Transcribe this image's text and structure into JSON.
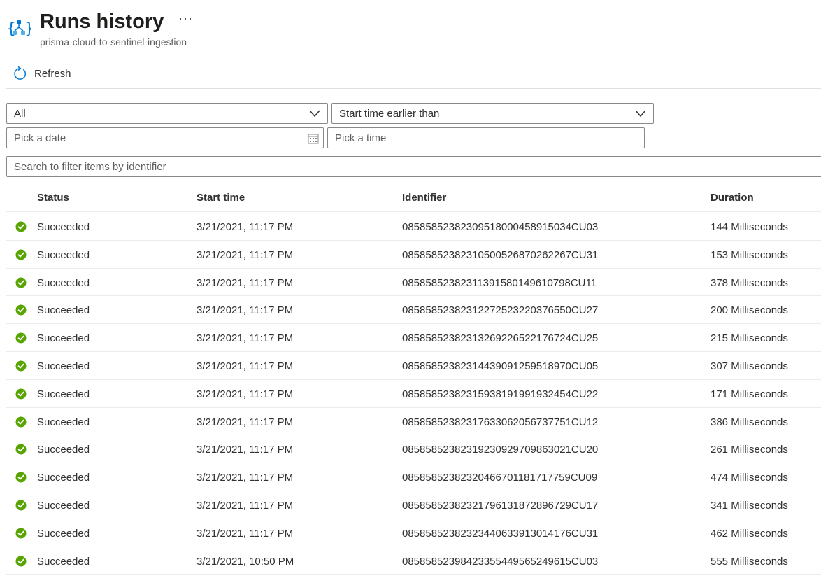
{
  "header": {
    "title": "Runs history",
    "more_label": "···",
    "subtitle": "prisma-cloud-to-sentinel-ingestion",
    "icon": "logic-app-icon"
  },
  "toolbar": {
    "refresh_label": "Refresh",
    "refresh_icon": "refresh-icon"
  },
  "filters": {
    "status_value": "All",
    "time_filter_value": "Start time earlier than",
    "date_placeholder": "Pick a date",
    "time_placeholder": "Pick a time",
    "search_placeholder": "Search to filter items by identifier"
  },
  "table": {
    "columns": {
      "status": "Status",
      "start_time": "Start time",
      "identifier": "Identifier",
      "duration": "Duration"
    },
    "rows": [
      {
        "status": "Succeeded",
        "start_time": "3/21/2021, 11:17 PM",
        "identifier": "08585852382309518000458915034CU03",
        "duration": "144 Milliseconds"
      },
      {
        "status": "Succeeded",
        "start_time": "3/21/2021, 11:17 PM",
        "identifier": "08585852382310500526870262267CU31",
        "duration": "153 Milliseconds"
      },
      {
        "status": "Succeeded",
        "start_time": "3/21/2021, 11:17 PM",
        "identifier": "08585852382311391580149610798CU11",
        "duration": "378 Milliseconds"
      },
      {
        "status": "Succeeded",
        "start_time": "3/21/2021, 11:17 PM",
        "identifier": "08585852382312272523220376550CU27",
        "duration": "200 Milliseconds"
      },
      {
        "status": "Succeeded",
        "start_time": "3/21/2021, 11:17 PM",
        "identifier": "08585852382313269226522176724CU25",
        "duration": "215 Milliseconds"
      },
      {
        "status": "Succeeded",
        "start_time": "3/21/2021, 11:17 PM",
        "identifier": "08585852382314439091259518970CU05",
        "duration": "307 Milliseconds"
      },
      {
        "status": "Succeeded",
        "start_time": "3/21/2021, 11:17 PM",
        "identifier": "08585852382315938191991932454CU22",
        "duration": "171 Milliseconds"
      },
      {
        "status": "Succeeded",
        "start_time": "3/21/2021, 11:17 PM",
        "identifier": "08585852382317633062056737751CU12",
        "duration": "386 Milliseconds"
      },
      {
        "status": "Succeeded",
        "start_time": "3/21/2021, 11:17 PM",
        "identifier": "08585852382319230929709863021CU20",
        "duration": "261 Milliseconds"
      },
      {
        "status": "Succeeded",
        "start_time": "3/21/2021, 11:17 PM",
        "identifier": "08585852382320466701181717759CU09",
        "duration": "474 Milliseconds"
      },
      {
        "status": "Succeeded",
        "start_time": "3/21/2021, 11:17 PM",
        "identifier": "08585852382321796131872896729CU17",
        "duration": "341 Milliseconds"
      },
      {
        "status": "Succeeded",
        "start_time": "3/21/2021, 11:17 PM",
        "identifier": "08585852382323440633913014176CU31",
        "duration": "462 Milliseconds"
      },
      {
        "status": "Succeeded",
        "start_time": "3/21/2021, 10:50 PM",
        "identifier": "08585852398423355449565249615CU03",
        "duration": "555 Milliseconds"
      }
    ]
  },
  "colors": {
    "accent": "#0078d4",
    "success": "#57a300",
    "border": "#8a8886",
    "divider": "#edebe9"
  }
}
